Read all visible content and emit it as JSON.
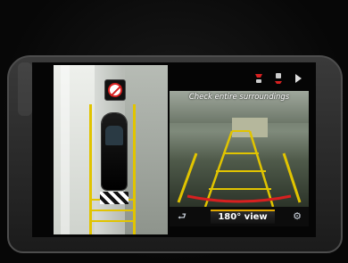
{
  "camera": {
    "message": "Check entire surroundings",
    "view_button_label": "180° view"
  },
  "icons": {
    "no_parking": "no-parking-icon",
    "back": "back-arrow-icon",
    "settings": "settings-icon",
    "sensor_front": "sensor-front-icon",
    "sensor_rear": "sensor-rear-icon",
    "play": "play-icon"
  },
  "colors": {
    "guide_yellow": "#e1c400",
    "warning_red": "#d82020",
    "selection_accent": "#e2a900"
  }
}
